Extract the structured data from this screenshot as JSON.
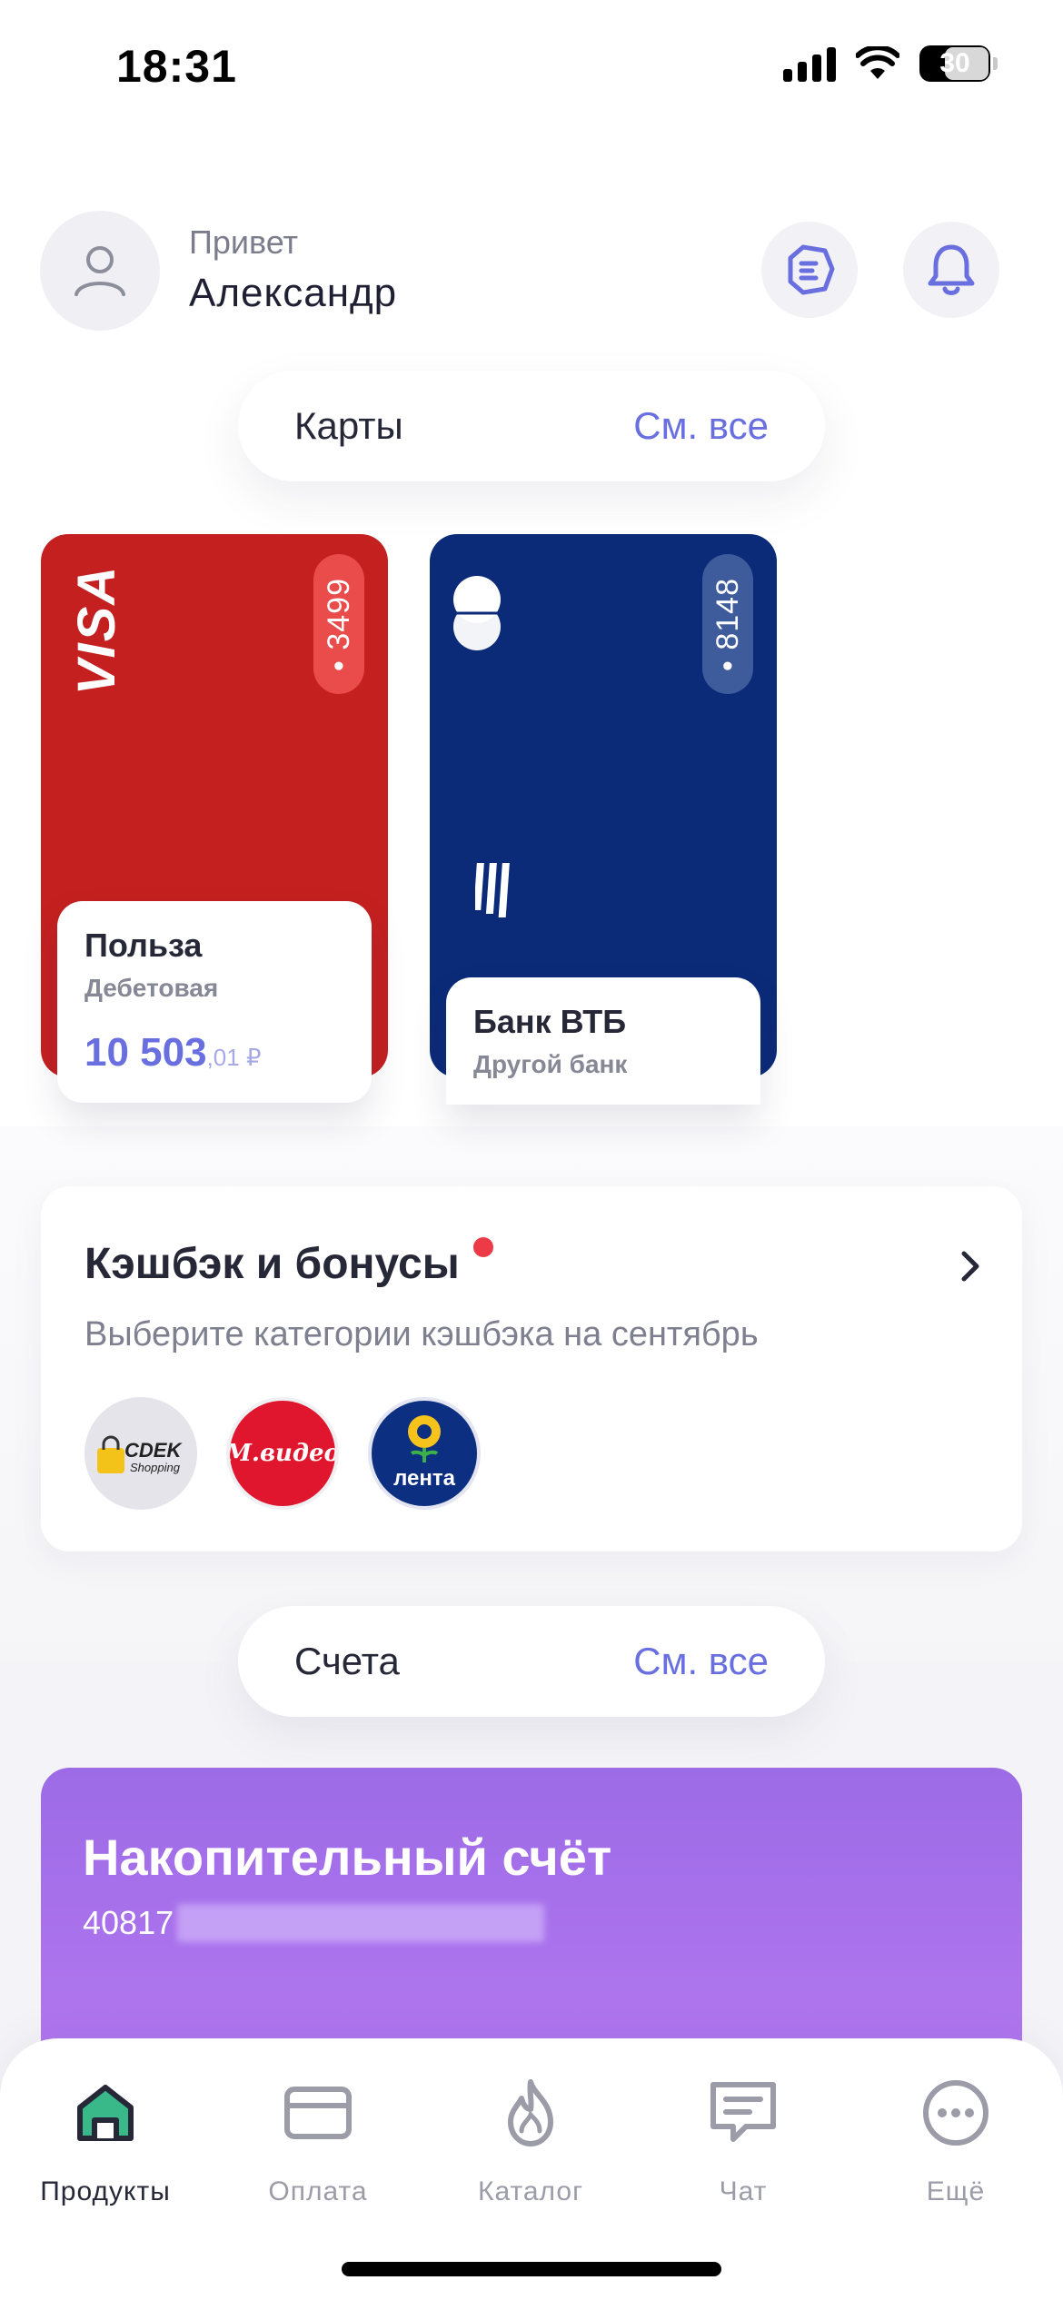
{
  "status": {
    "time": "18:31",
    "battery": "30"
  },
  "header": {
    "greeting": "Привет",
    "name": "Александр"
  },
  "cards_section": {
    "title": "Карты",
    "link": "См. все"
  },
  "cards": [
    {
      "brand": "VISA",
      "last4": "• 3499",
      "title": "Польза",
      "subtitle": "Дебетовая",
      "amount_main": "10 503",
      "amount_cents": ",01 ₽",
      "color": "#c42020"
    },
    {
      "last4": "• 8148",
      "title": "Банк ВТБ",
      "subtitle": "Другой банк",
      "color": "#0b2a78"
    }
  ],
  "cashback": {
    "title": "Кэшбэк и бонусы",
    "subtitle": "Выберите категории кэшбэка на сентябрь",
    "partners": [
      {
        "name": "CDEK Shopping",
        "logo_text": "CDEK",
        "logo_sub": "Shopping"
      },
      {
        "name": "М.видео",
        "logo_text": "М.видео"
      },
      {
        "name": "Лента",
        "logo_text": "лента"
      }
    ]
  },
  "accounts_section": {
    "title": "Счета",
    "link": "См. все"
  },
  "savings": {
    "title": "Накопительный счёт",
    "account_prefix": "40817"
  },
  "tabbar": {
    "items": [
      {
        "label": "Продукты",
        "icon": "home-icon",
        "active": true
      },
      {
        "label": "Оплата",
        "icon": "card-icon",
        "active": false
      },
      {
        "label": "Каталог",
        "icon": "flame-icon",
        "active": false
      },
      {
        "label": "Чат",
        "icon": "chat-icon",
        "active": false
      },
      {
        "label": "Ещё",
        "icon": "more-icon",
        "active": false
      }
    ]
  },
  "colors": {
    "accent": "#6a6fe0",
    "savings": "#a56feb",
    "notification": "#ec3b46"
  }
}
